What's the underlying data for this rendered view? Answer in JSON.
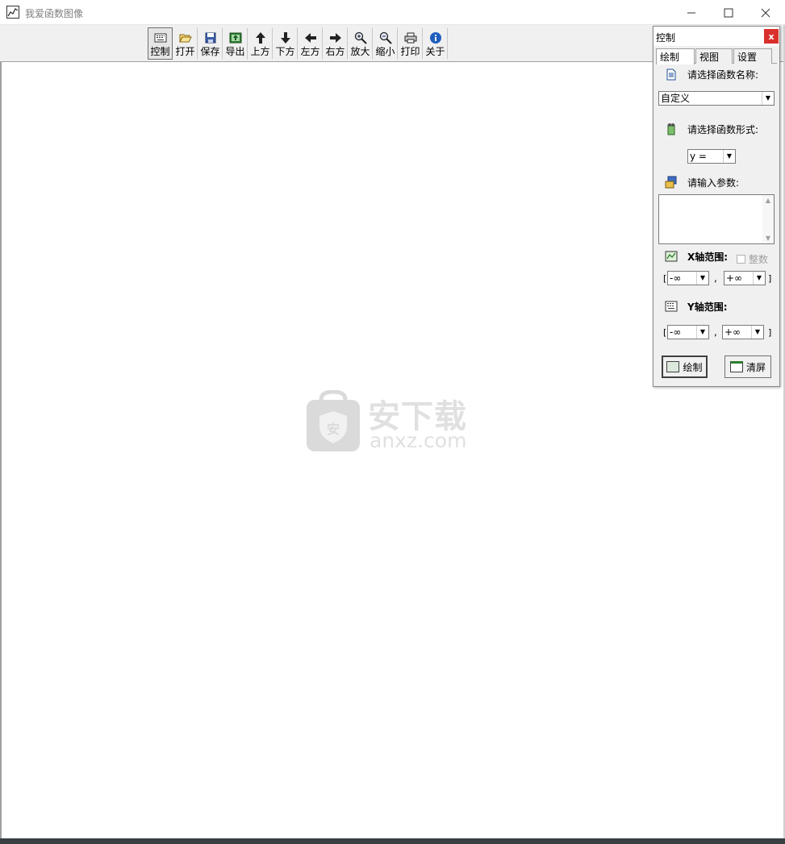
{
  "window": {
    "title": "我爱函数图像",
    "minimize_icon": "minimize-icon",
    "maximize_icon": "maximize-icon",
    "close_icon": "close-icon"
  },
  "toolbar": {
    "items": [
      {
        "label": "控制",
        "icon": "keyboard-icon",
        "active": true
      },
      {
        "label": "打开",
        "icon": "folder-open-icon"
      },
      {
        "label": "保存",
        "icon": "floppy-disk-icon"
      },
      {
        "label": "导出",
        "icon": "export-image-icon"
      },
      {
        "label": "上方",
        "icon": "arrow-up-icon"
      },
      {
        "label": "下方",
        "icon": "arrow-down-icon"
      },
      {
        "label": "左方",
        "icon": "arrow-left-icon"
      },
      {
        "label": "右方",
        "icon": "arrow-right-icon"
      },
      {
        "label": "放大",
        "icon": "zoom-in-icon"
      },
      {
        "label": "缩小",
        "icon": "zoom-out-icon"
      },
      {
        "label": "打印",
        "icon": "printer-icon"
      },
      {
        "label": "关于",
        "icon": "info-icon"
      }
    ]
  },
  "watermark": {
    "cn": "安下载",
    "en": "anxz.com"
  },
  "panel": {
    "title": "控制",
    "close_label": "x",
    "tabs": [
      "绘制",
      "视图",
      "设置"
    ],
    "function_name_label": "请选择函数名称:",
    "function_name_value": "自定义",
    "function_form_label": "请选择函数形式:",
    "function_form_value": "y =",
    "params_label": "请输入参数:",
    "params_value": "",
    "x_range_label": "X轴范围:",
    "integer_label": "整数",
    "x_min": "-∞",
    "x_max": "+∞",
    "y_range_label": "Y轴范围:",
    "y_min": "-∞",
    "y_max": "+∞",
    "bracket_open": "[",
    "bracket_close": "]",
    "comma": ",",
    "draw_button": "绘制",
    "clear_button": "清屏"
  },
  "colors": {
    "panel_close_bg": "#d9302c",
    "toolbar_bg": "#f0f0f0",
    "bottom_bar": "#3a3f44"
  }
}
